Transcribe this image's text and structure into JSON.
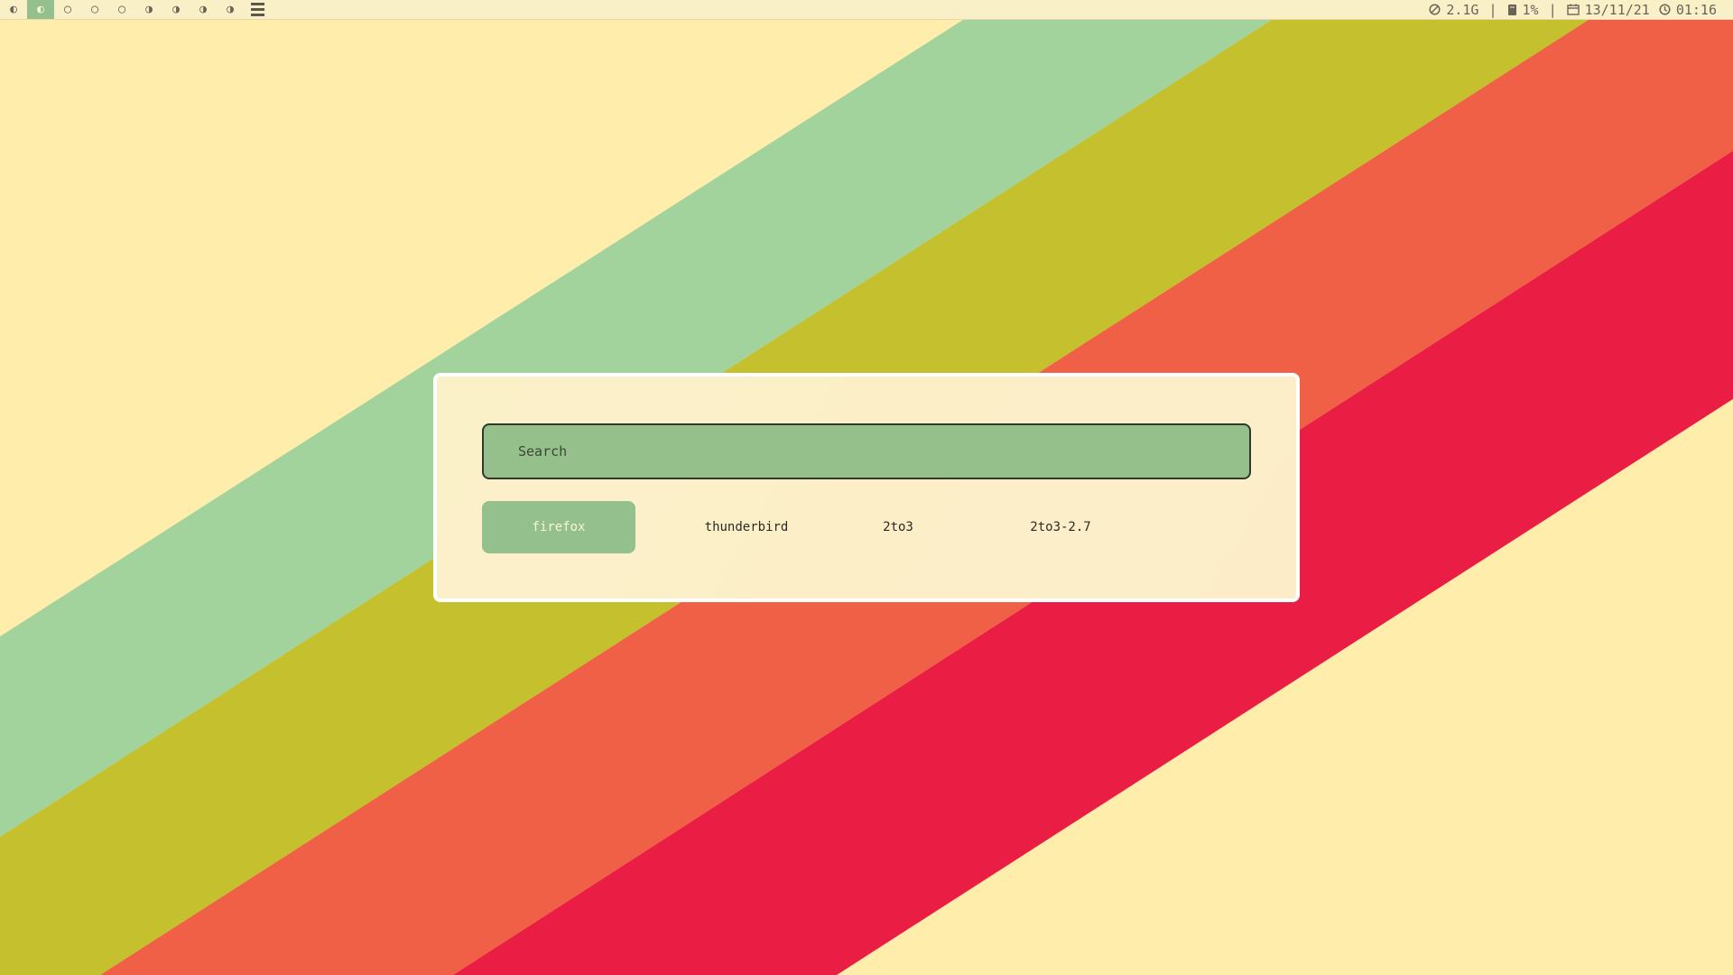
{
  "topbar": {
    "workspaces": [
      {
        "glyph": "◐",
        "active": false
      },
      {
        "glyph": "◐",
        "active": true
      },
      {
        "glyph": "◯",
        "active": false
      },
      {
        "glyph": "◯",
        "active": false
      },
      {
        "glyph": "◯",
        "active": false
      },
      {
        "glyph": "◑",
        "active": false
      },
      {
        "glyph": "◑",
        "active": false
      },
      {
        "glyph": "◑",
        "active": false
      },
      {
        "glyph": "◑",
        "active": false
      }
    ],
    "layout_icon": "tiled-layout-icon",
    "status": {
      "memory": "2.1G",
      "disk": "1%",
      "date": "13/11/21",
      "time": "01:16",
      "separator": "|"
    }
  },
  "launcher": {
    "search_placeholder": "Search",
    "search_value": "",
    "results": [
      {
        "label": "firefox",
        "selected": true
      },
      {
        "label": "thunderbird",
        "selected": false
      },
      {
        "label": "2to3",
        "selected": false
      },
      {
        "label": "2to3-2.7",
        "selected": false
      }
    ]
  },
  "colors": {
    "accent": "#93c08d",
    "bar_background": "#faf0c8",
    "text": "#6b6456",
    "wallpaper": [
      "#ffedab",
      "#a2d39d",
      "#c5c02e",
      "#f06046",
      "#ea1e44"
    ]
  }
}
